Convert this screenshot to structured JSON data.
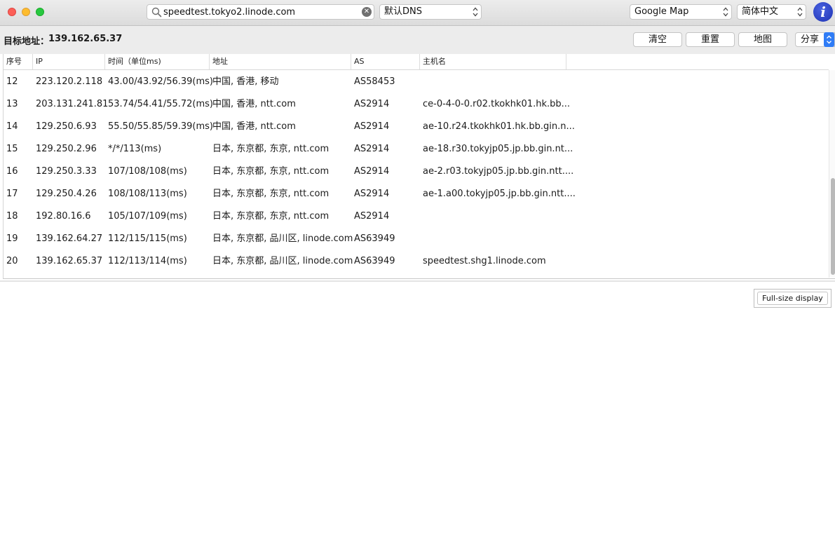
{
  "toolbar": {
    "search_value": "speedtest.tokyo2.linode.com",
    "clear_symbol": "✕",
    "dns_select": "默认DNS",
    "map_select": "Google Map",
    "language_select": "简体中文",
    "info_symbol": "i"
  },
  "target": {
    "label": "目标地址：",
    "value": "139.162.65.37"
  },
  "actions": {
    "clear": "清空",
    "reset": "重置",
    "map": "地图",
    "share": "分享"
  },
  "table": {
    "headers": [
      "序号",
      "IP",
      "时间（单位ms)",
      "地址",
      "AS",
      "主机名"
    ],
    "rows": [
      [
        "12",
        "223.120.2.118",
        "43.00/43.92/56.39(ms)",
        "中国, 香港, 移动",
        "AS58453",
        ""
      ],
      [
        "13",
        "203.131.241.81",
        "53.74/54.41/55.72(ms)",
        "中国, 香港, ntt.com",
        "AS2914",
        "ce-0-4-0-0.r02.tkokhk01.hk.bb..."
      ],
      [
        "14",
        "129.250.6.93",
        "55.50/55.85/59.39(ms)",
        "中国, 香港, ntt.com",
        "AS2914",
        "ae-10.r24.tkokhk01.hk.bb.gin.n..."
      ],
      [
        "15",
        "129.250.2.96",
        "*/*/113(ms)",
        "日本, 东京都, 东京, ntt.com",
        "AS2914",
        "ae-18.r30.tokyjp05.jp.bb.gin.nt..."
      ],
      [
        "16",
        "129.250.3.33",
        "107/108/108(ms)",
        "日本, 东京都, 东京, ntt.com",
        "AS2914",
        "ae-2.r03.tokyjp05.jp.bb.gin.ntt...."
      ],
      [
        "17",
        "129.250.4.26",
        "108/108/113(ms)",
        "日本, 东京都, 东京, ntt.com",
        "AS2914",
        "ae-1.a00.tokyjp05.jp.bb.gin.ntt...."
      ],
      [
        "18",
        "192.80.16.6",
        "105/107/109(ms)",
        "日本, 东京都, 东京, ntt.com",
        "AS2914",
        ""
      ],
      [
        "19",
        "139.162.64.27",
        "112/115/115(ms)",
        "日本, 东京都, 品川区, linode.com",
        "AS63949",
        ""
      ],
      [
        "20",
        "139.162.65.37",
        "112/113/114(ms)",
        "日本, 东京都, 品川区, linode.com",
        "AS63949",
        "speedtest.shg1.linode.com"
      ]
    ]
  },
  "fullsize_button": "Full-size display",
  "colors": {
    "close_light": "#fc5f57",
    "minimize_light": "#fdbc2e",
    "maximize_light": "#28c840",
    "accent_blue": "#2f7cf6",
    "info_blue": "#2a3fc4"
  }
}
